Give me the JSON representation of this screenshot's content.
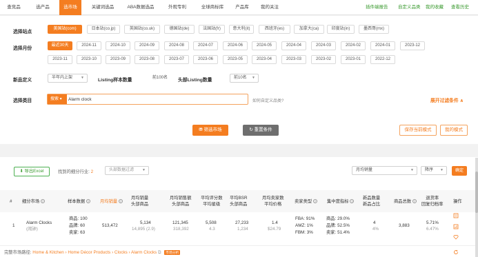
{
  "nav": {
    "tabs": [
      {
        "label": "查竞品"
      },
      {
        "label": "选产品"
      },
      {
        "label": "选市场"
      },
      {
        "label": "关键词选品"
      },
      {
        "label": "ABA数据选品"
      },
      {
        "label": "外观专利"
      },
      {
        "label": "全球商标库"
      },
      {
        "label": "产品库"
      },
      {
        "label": "我的关注"
      }
    ],
    "active_index": 2,
    "right_links": [
      {
        "label": "插件端报告"
      },
      {
        "label": "自定义品类"
      },
      {
        "label": "我的收藏"
      },
      {
        "label": "查看历史"
      }
    ]
  },
  "filters": {
    "site": {
      "label": "选择站点",
      "options": [
        "美国站(com)",
        "日本站(co.jp)",
        "英国站(co.uk)",
        "德国站(de)",
        "法国站(fr)",
        "意大利(it)",
        "西班牙(es)",
        "加拿大(ca)",
        "印度站(in)",
        "墨西哥(mx)"
      ],
      "selected_index": 0
    },
    "month": {
      "label": "选择月份",
      "options_row1": [
        "最近30天",
        "2024-11",
        "2024-10",
        "2024-09",
        "2024-08",
        "2024-07",
        "2024-06",
        "2024-05",
        "2024-04",
        "2024-03",
        "2024-02",
        "2024-01",
        "2023-12"
      ],
      "options_row2": [
        "2023-11",
        "2023-10",
        "2023-09",
        "2023-08",
        "2023-07",
        "2023-06",
        "2023-05",
        "2023-04",
        "2023-03",
        "2023-02",
        "2023-01",
        "2022-12"
      ],
      "selected": "最近30天"
    },
    "new_product": {
      "label": "新品定义",
      "value": "半年内上架"
    },
    "listing_sample": {
      "label": "Listing样本数量",
      "value": "前100名"
    },
    "head_listing": {
      "label": "头部Listing数量",
      "value": "前10名"
    },
    "category": {
      "label": "选择类目",
      "search_type": "搜索",
      "value": "Alarm clock",
      "hint": "如何自定义品类?"
    },
    "advanced": "展开过滤条件 ∧",
    "buttons": {
      "filter": "筛选市场",
      "reset": "重置条件",
      "save": "保存当前模式",
      "my_mode": "我的模式"
    }
  },
  "results": {
    "export_label": "导出Excel",
    "found_prefix": "找到的细分行业:",
    "found_count": "2",
    "data_filter": "头部数据过滤",
    "sort_field": "月均销量",
    "sort_order": "降序",
    "confirm": "确定",
    "headers": {
      "no": "#",
      "market": "细分市场",
      "samples": "样本数据",
      "monthly_sales": "月均销量",
      "head_sales": "月均销量\n头部商品",
      "revenue": "月均销售额\n头部商品",
      "reviews": "平均评分数\n平均星级",
      "bsr": "平均BSR\n头部商品",
      "price": "月均卖家数\n平均价格",
      "seller_type": "卖家类型",
      "concentration": "集中度指标",
      "new_ratio": "新品数量\n新品占比",
      "total_products": "商品总数",
      "bounce": "退货率\n回复归档率",
      "actions": "操作"
    },
    "row": {
      "index": "1",
      "market_name": "Alarm Clocks",
      "market_sub": "(闹钟)",
      "samples": [
        "商品: 100",
        "品牌: 60",
        "卖家: 63"
      ],
      "monthly_sales": "513,472",
      "head_sales_main": "5,134",
      "head_sales_sub": "14,895 (2.9)",
      "revenue_main": "121,345",
      "revenue_sub": "318,392",
      "reviews_main": "5,508",
      "reviews_sub": "4.3",
      "bsr_main": "27,233",
      "bsr_sub": "1,234",
      "price_main": "1.4",
      "price_sub": "$24.79",
      "seller_type": [
        "FBA: 91%",
        "AMZ: 1%",
        "FBM: 3%"
      ],
      "concentration": [
        "商品: 29.0%",
        "品牌: 52.5%",
        "卖家: 51.4%"
      ],
      "new_main": "4",
      "new_sub": "4%",
      "total_products": "3,883",
      "bounce_main": "5.71%",
      "bounce_sub": "6.47%"
    },
    "breadcrumb": {
      "prefix": "完整市场路径:",
      "path": "Home & Kitchen › Home Décor Products › Clocks › Alarm Clocks",
      "badge": "市场分析"
    }
  },
  "colors": {
    "accent": "#f47d20",
    "green": "#3a9a2f"
  }
}
